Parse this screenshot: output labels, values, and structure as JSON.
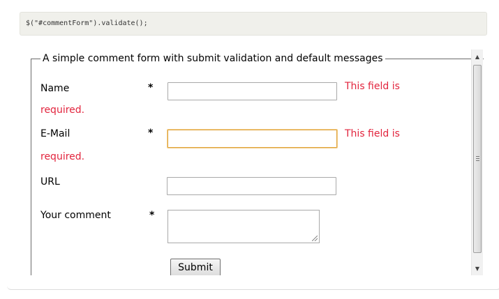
{
  "code": {
    "snippet": "$(\"#commentForm\").validate();"
  },
  "form": {
    "legend": "A simple comment form with submit validation and default messages",
    "required_marker": "*",
    "fields": {
      "name": {
        "label": "Name",
        "value": "",
        "error_line1": "This field is",
        "error_line2": "required."
      },
      "email": {
        "label": "E-Mail",
        "value": "",
        "error_line1": "This field is",
        "error_line2": "required."
      },
      "url": {
        "label": "URL",
        "value": ""
      },
      "comment": {
        "label": "Your comment",
        "value": ""
      }
    },
    "submit_label": "Submit"
  },
  "scrollbar": {
    "up_icon": "arrow-up-icon",
    "down_icon": "arrow-down-icon",
    "thumb_position": 0
  },
  "colors": {
    "error": "#e2243d",
    "focus_border": "#e0a53d"
  }
}
